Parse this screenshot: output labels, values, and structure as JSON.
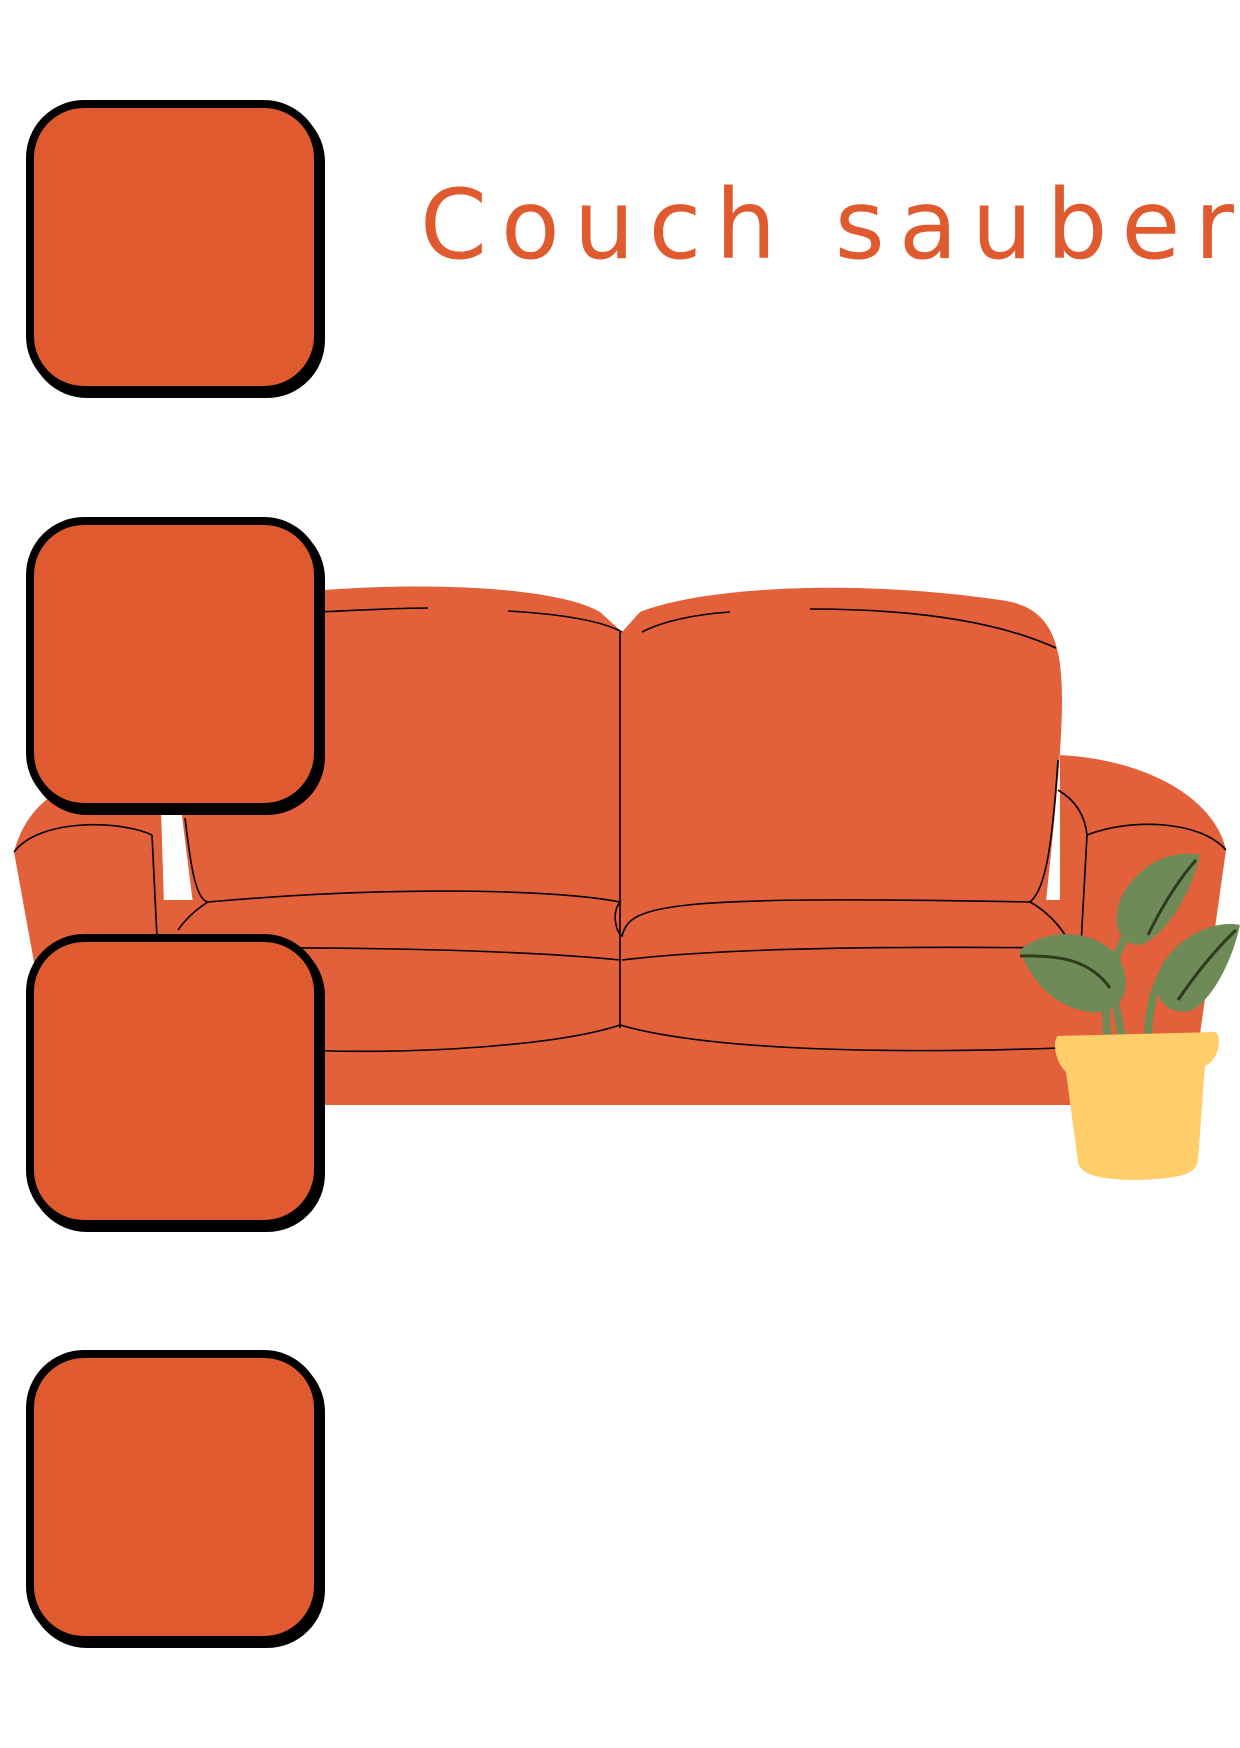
{
  "title": "Couch sauber",
  "colors": {
    "accent": "#E05A30",
    "couch": "#E2603A",
    "tile": "#E05A30",
    "leaf": "#6E8A57",
    "pot": "#FFCE6A",
    "outline": "#000000",
    "background": "#FFFFFF"
  },
  "tiles": [
    {
      "icon": "empty-square"
    },
    {
      "icon": "empty-square"
    },
    {
      "icon": "empty-square"
    },
    {
      "icon": "empty-square"
    }
  ],
  "illustration": {
    "main": "couch-icon",
    "decoration": "potted-plant-icon"
  }
}
